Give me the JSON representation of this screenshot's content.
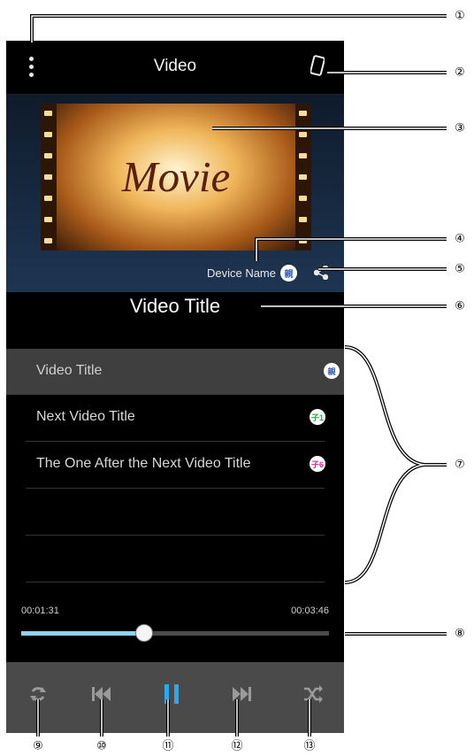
{
  "app": {
    "title": "Video"
  },
  "icons": {
    "menu": "vertical-ellipsis-icon",
    "device": "smartphone-icon",
    "share": "share-icon",
    "repeat": "repeat-icon",
    "previous": "skip-previous-icon",
    "pause": "pause-icon",
    "next": "skip-next-icon",
    "shuffle": "shuffle-icon"
  },
  "poster": {
    "text": "Movie"
  },
  "device": {
    "name": "Device Name",
    "badge": "親"
  },
  "now_playing": {
    "title": "Video Title"
  },
  "playlist": [
    {
      "title": "Video Title",
      "badge": "親",
      "badge_color": "#2b5bbd",
      "active": true
    },
    {
      "title": "Next Video Title",
      "badge": "子1",
      "badge_color": "#2da84a",
      "active": false
    },
    {
      "title": "The One After the Next Video Title",
      "badge": "子6",
      "badge_color": "#d42f8b",
      "active": false
    },
    {
      "title": "",
      "badge": "",
      "active": false
    },
    {
      "title": "",
      "badge": "",
      "active": false
    }
  ],
  "playback": {
    "elapsed": "00:01:31",
    "duration": "00:03:46",
    "progress": 0.4
  },
  "colors": {
    "accent": "#2aa9f0",
    "progress_fill": "#8dd2f3",
    "controls_bg": "#4a4a4a",
    "inactive_control": "#9a9a9a"
  },
  "callouts": [
    "①",
    "②",
    "③",
    "④",
    "⑤",
    "⑥",
    "⑦",
    "⑧",
    "⑨",
    "⑩",
    "⑪",
    "⑫",
    "⑬"
  ]
}
